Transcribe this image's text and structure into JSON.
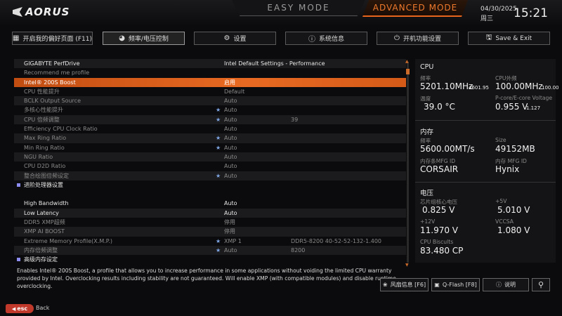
{
  "header": {
    "logo_text": "AORUS",
    "easy_mode": "EASY MODE",
    "advanced_mode": "ADVANCED MODE",
    "date": "04/30/2025",
    "weekday": "周三",
    "time": "15:21"
  },
  "tabs": [
    {
      "label": "开启我的偏好页面 (F11)",
      "icon": "bookmark-icon"
    },
    {
      "label": "频率/电压控制",
      "icon": "gauge-icon"
    },
    {
      "label": "设置",
      "icon": "gear-icon"
    },
    {
      "label": "系统信息",
      "icon": "info-icon"
    },
    {
      "label": "开机功能设置",
      "icon": "power-icon"
    },
    {
      "label": "Save & Exit",
      "icon": "save-icon"
    }
  ],
  "settings": [
    {
      "label": "GIGABYTE PerfDrive",
      "value": "Intel Default Settings - Performance",
      "extra": "",
      "star": false,
      "state": "bright"
    },
    {
      "label": "Recommend me profile",
      "value": "",
      "extra": "",
      "star": false,
      "state": "dim"
    },
    {
      "label": "Intel® 200S Boost",
      "value": "启用",
      "extra": "",
      "star": false,
      "state": "selected"
    },
    {
      "label": "CPU 性能提升",
      "value": "Default",
      "extra": "",
      "star": false,
      "state": "dim"
    },
    {
      "label": "BCLK Output Source",
      "value": "Auto",
      "extra": "",
      "star": false,
      "state": "dim"
    },
    {
      "label": "多核心性能提升",
      "value": "Auto",
      "extra": "",
      "star": true,
      "state": "dim"
    },
    {
      "label": "CPU 倍频调整",
      "value": "Auto",
      "extra": "39",
      "star": true,
      "state": "dim"
    },
    {
      "label": "Efficiency CPU Clock Ratio",
      "value": "Auto",
      "extra": "",
      "star": false,
      "state": "dim"
    },
    {
      "label": "Max Ring Ratio",
      "value": "Auto",
      "extra": "",
      "star": true,
      "state": "dim"
    },
    {
      "label": "Min Ring Ratio",
      "value": "Auto",
      "extra": "",
      "star": true,
      "state": "dim"
    },
    {
      "label": "NGU Ratio",
      "value": "Auto",
      "extra": "",
      "star": false,
      "state": "dim"
    },
    {
      "label": "CPU D2D Ratio",
      "value": "Auto",
      "extra": "",
      "star": false,
      "state": "dim"
    },
    {
      "label": "整合绘图倍频设定",
      "value": "Auto",
      "extra": "",
      "star": true,
      "state": "dim"
    },
    {
      "label": "进阶处理器设置",
      "value": "",
      "extra": "",
      "star": false,
      "state": "section"
    },
    {
      "label": "",
      "value": "",
      "extra": "",
      "star": false,
      "state": "blank"
    },
    {
      "label": "High Bandwidth",
      "value": "Auto",
      "extra": "",
      "star": false,
      "state": "bright"
    },
    {
      "label": "Low Latency",
      "value": "Auto",
      "extra": "",
      "star": false,
      "state": "bright"
    },
    {
      "label": "DDR5 XMP超频",
      "value": "停用",
      "extra": "",
      "star": false,
      "state": "dim"
    },
    {
      "label": "XMP AI BOOST",
      "value": "停用",
      "extra": "",
      "star": false,
      "state": "dim"
    },
    {
      "label": "Extreme Memory Profile(X.M.P.)",
      "value": "XMP 1",
      "extra": "DDR5-8200 40-52-52-132-1.400",
      "star": true,
      "state": "dim"
    },
    {
      "label": "内存倍频调整",
      "value": "Auto",
      "extra": "8200",
      "star": true,
      "state": "dim"
    },
    {
      "label": "高级内存设定",
      "value": "",
      "extra": "",
      "star": false,
      "state": "section"
    }
  ],
  "help_text": "Enables Intel® 200S Boost, a profile that allows you to increase performance in some applications without voiding the limited CPU warranty provided by Intel. Overclocking results including stability are not guaranteed. Will enable XMP (with compatible modules) and disable runtime overclocking.",
  "panel": {
    "cpu": {
      "title": "CPU",
      "freq_label": "频率",
      "freq_value": "5201.10MHz",
      "freq_sub": "4601.95",
      "ext_label": "CPU外频",
      "ext_value": "100.00MHz",
      "ext_sub": "100.00",
      "temp_label": "温度",
      "temp_value": "39.0 °C",
      "pe_label": "P-core/E-core Voltage",
      "pe_value": "0.955 V",
      "pe_sub": "1.127"
    },
    "memory": {
      "title": "内存",
      "freq_label": "频率",
      "freq_value": "5600.00MT/s",
      "size_label": "Size",
      "size_value": "49152MB",
      "mfg1_label": "内存条MFG ID",
      "mfg1_value": "CORSAIR",
      "mfg2_label": "内存 MFG ID",
      "mfg2_value": "Hynix"
    },
    "voltage": {
      "title": "电压",
      "core_label": "芯片组核心电压",
      "core_value": "0.825 V",
      "p5_label": "+5V",
      "p5_value": "5.010 V",
      "p12_label": "+12V",
      "p12_value": "11.970 V",
      "vccsa_label": "VCCSA",
      "vccsa_value": "1.080 V",
      "bisc_label": "CPU Biscults",
      "bisc_value": "83.480 CP"
    }
  },
  "bottom_buttons": [
    {
      "label": "风扇信息 [F6]",
      "icon": "fan-icon"
    },
    {
      "label": "Q-Flash [F8]",
      "icon": "chip-icon"
    },
    {
      "label": "说明",
      "icon": "help-icon"
    },
    {
      "label": "",
      "icon": "search-icon"
    }
  ],
  "footer": {
    "esc_label": "esc",
    "back_label": "Back"
  },
  "colors": {
    "accent": "#e8651e",
    "star": "#7fa7e6",
    "section_marker": "#8c8cf0"
  }
}
